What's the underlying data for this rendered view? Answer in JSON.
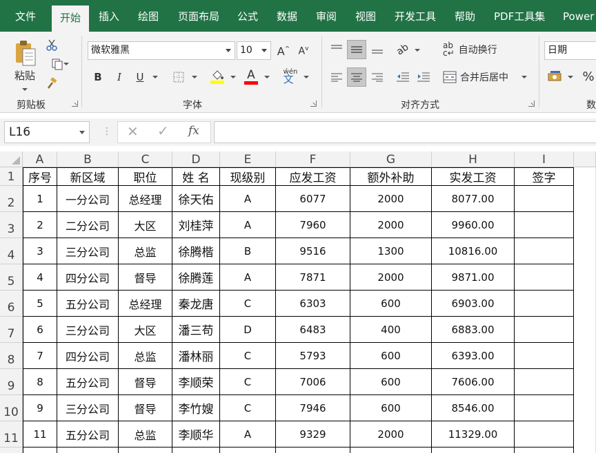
{
  "ribbon_tabs": [
    "文件",
    "开始",
    "插入",
    "绘图",
    "页面布局",
    "公式",
    "数据",
    "审阅",
    "视图",
    "开发工具",
    "帮助",
    "PDF工具集",
    "Power"
  ],
  "active_tab": "开始",
  "clipboard": {
    "paste_label": "粘贴",
    "group_label": "剪贴板"
  },
  "font": {
    "name": "微软雅黑",
    "size": "10",
    "group_label": "字体",
    "bold": "B",
    "italic": "I",
    "underline": "U",
    "fill_color": "#ffff00",
    "font_color": "#ff0000"
  },
  "alignment": {
    "wrap_text": "自动换行",
    "merge_center": "合并后居中",
    "group_label": "对齐方式"
  },
  "number": {
    "format": "日期",
    "percent": "%",
    "group_label_partial": "数"
  },
  "formula_bar": {
    "name_box": "L16",
    "fx_label": "fx",
    "value": ""
  },
  "sheet": {
    "col_letters": [
      "A",
      "B",
      "C",
      "D",
      "E",
      "F",
      "G",
      "H",
      "I"
    ],
    "row_numbers": [
      "1",
      "2",
      "3",
      "4",
      "5",
      "6",
      "7",
      "8",
      "9",
      "10",
      "11"
    ],
    "headers": [
      "序号",
      "新区域",
      "职位",
      "姓 名",
      "现级别",
      "应发工资",
      "额外补助",
      "实发工资",
      "签字"
    ],
    "rows": [
      [
        "1",
        "一分公司",
        "总经理",
        "徐天佑",
        "A",
        "6077",
        "2000",
        "8077.00",
        ""
      ],
      [
        "2",
        "二分公司",
        "大区",
        "刘桂萍",
        "A",
        "7960",
        "2000",
        "9960.00",
        ""
      ],
      [
        "3",
        "三分公司",
        "总监",
        "徐腾楷",
        "B",
        "9516",
        "1300",
        "10816.00",
        ""
      ],
      [
        "4",
        "四分公司",
        "督导",
        "徐腾莲",
        "A",
        "7871",
        "2000",
        "9871.00",
        ""
      ],
      [
        "5",
        "五分公司",
        "总经理",
        "秦龙唐",
        "C",
        "6303",
        "600",
        "6903.00",
        ""
      ],
      [
        "6",
        "三分公司",
        "大区",
        "潘三苟",
        "D",
        "6483",
        "400",
        "6883.00",
        ""
      ],
      [
        "7",
        "四分公司",
        "总监",
        "潘林丽",
        "C",
        "5793",
        "600",
        "6393.00",
        ""
      ],
      [
        "8",
        "五分公司",
        "督导",
        "李顺荣",
        "C",
        "7006",
        "600",
        "7606.00",
        ""
      ],
      [
        "9",
        "三分公司",
        "督导",
        "李竹嫂",
        "C",
        "7946",
        "600",
        "8546.00",
        ""
      ],
      [
        "11",
        "五分公司",
        "总监",
        "李顺华",
        "A",
        "9329",
        "2000",
        "11329.00",
        ""
      ]
    ]
  },
  "colors": {
    "excel_green": "#217346",
    "ribbon_bg": "#f3f3f3"
  }
}
